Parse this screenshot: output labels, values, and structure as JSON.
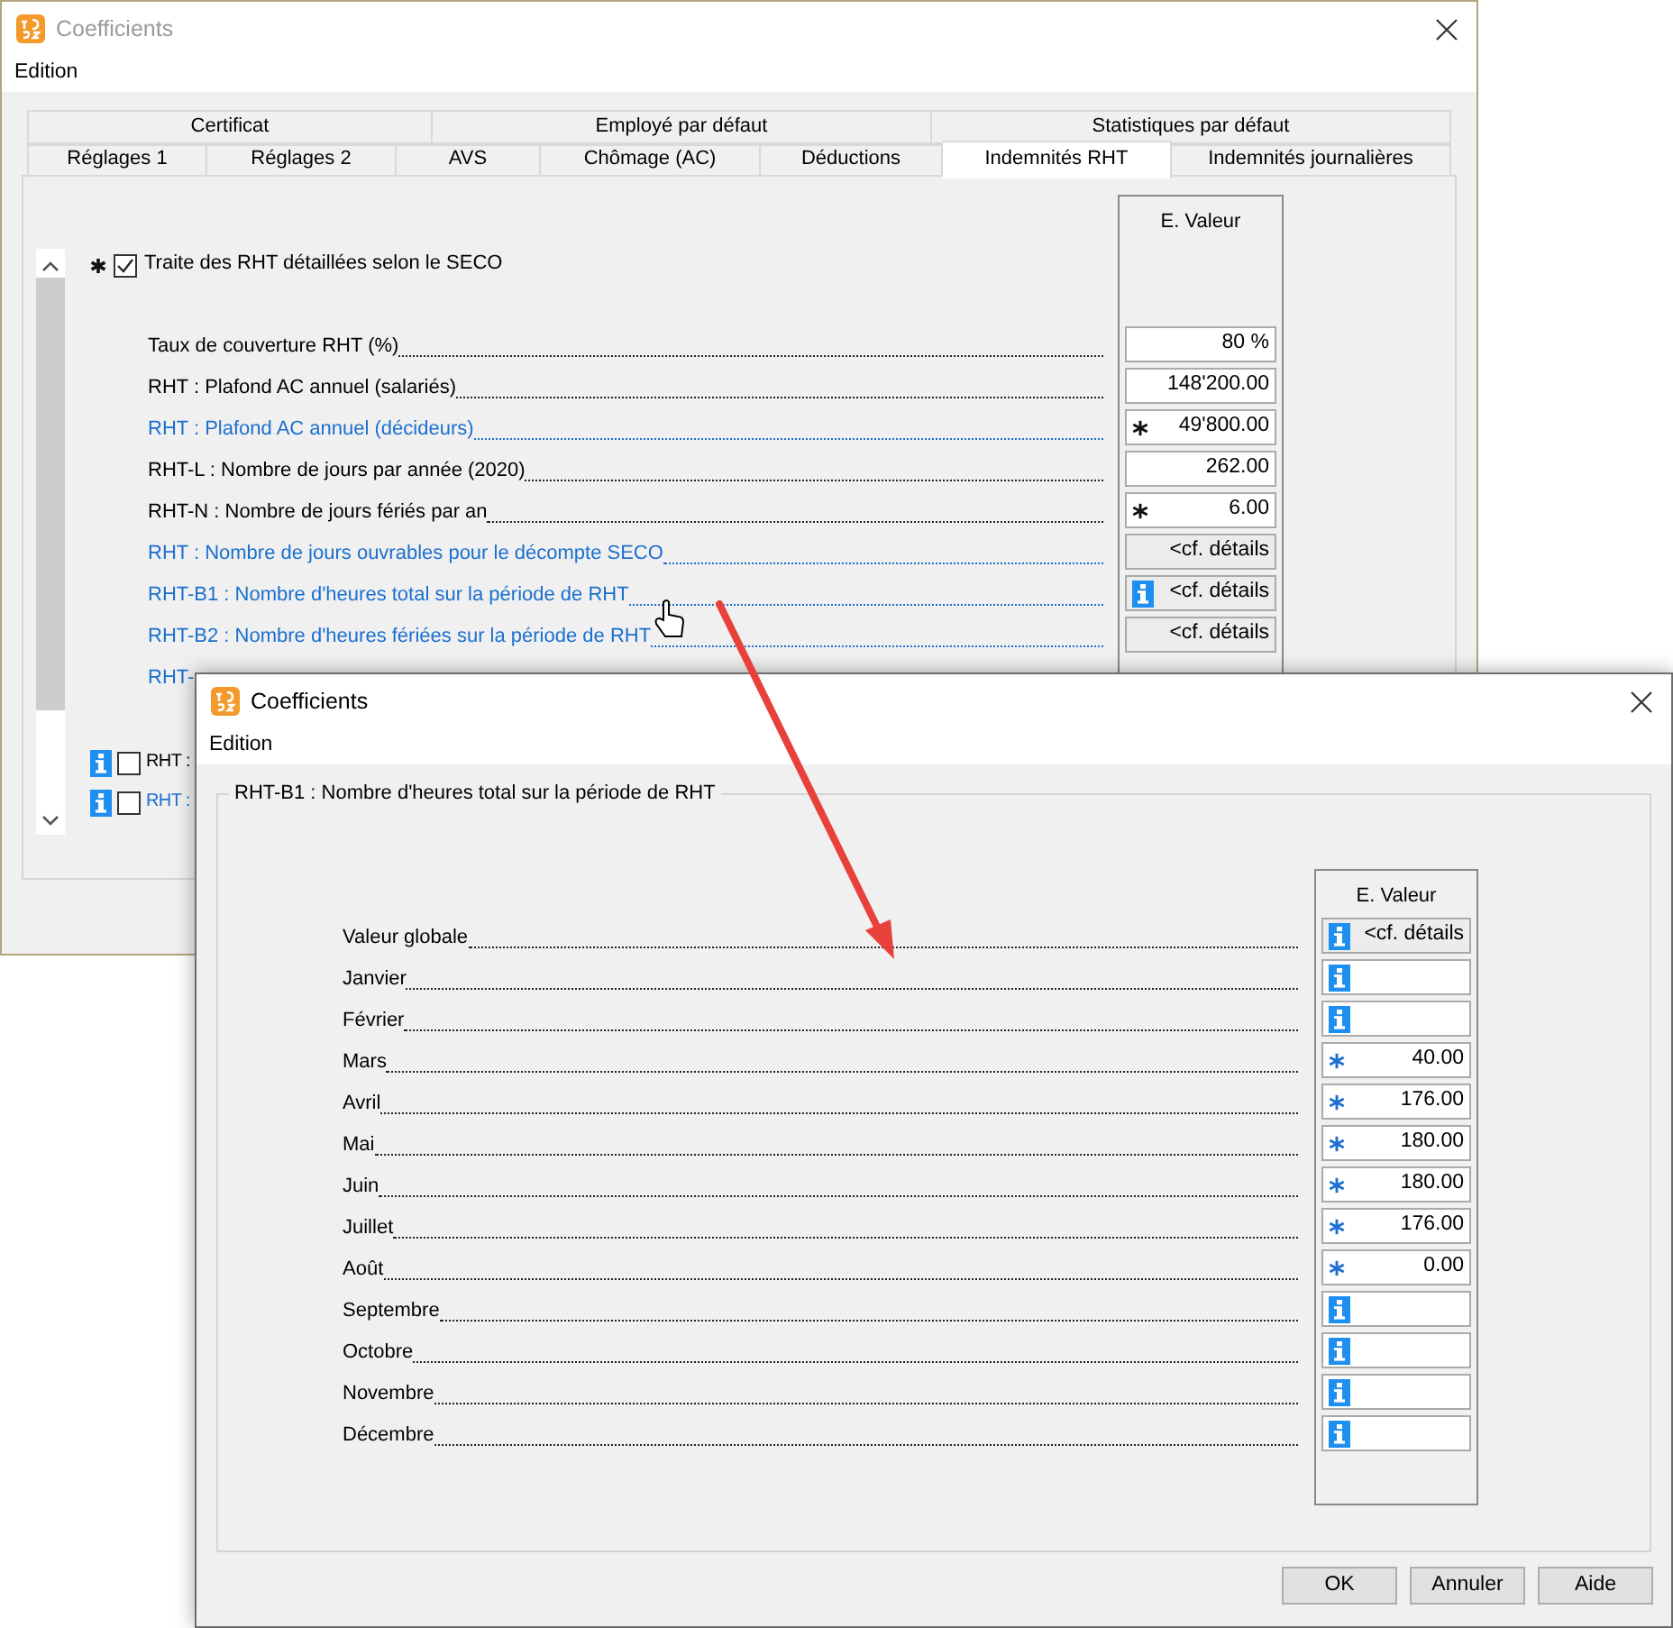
{
  "back_window": {
    "title": "Coefficients",
    "menu": [
      "Edition"
    ],
    "tabs_row1": [
      {
        "label": "Certificat",
        "selected": false
      },
      {
        "label": "Employé par défaut",
        "selected": false
      },
      {
        "label": "Statistiques par défaut",
        "selected": false
      }
    ],
    "tabs_row2": [
      {
        "label": "Réglages 1",
        "selected": false
      },
      {
        "label": "Réglages 2",
        "selected": false
      },
      {
        "label": "AVS",
        "selected": false
      },
      {
        "label": "Chômage (AC)",
        "selected": false
      },
      {
        "label": "Déductions",
        "selected": false
      },
      {
        "label": "Indemnités RHT",
        "selected": true
      },
      {
        "label": "Indemnités journalières",
        "selected": false
      }
    ],
    "column_header": "E. Valeur",
    "master": {
      "starred": true,
      "checked": true,
      "label": "Traite des RHT détaillées selon le SECO"
    },
    "rows": [
      {
        "label": "Taux de couverture RHT (%)",
        "linked": false,
        "starred": false,
        "info": false,
        "kind": "input",
        "value": "80 %"
      },
      {
        "label": "RHT : Plafond AC annuel (salariés)",
        "linked": false,
        "starred": false,
        "info": false,
        "kind": "input",
        "value": "148'200.00"
      },
      {
        "label": "RHT : Plafond AC annuel (décideurs)",
        "linked": true,
        "starred": true,
        "info": false,
        "kind": "input",
        "value": "49'800.00"
      },
      {
        "label": "RHT-L : Nombre de jours par année (2020)",
        "linked": false,
        "starred": false,
        "info": false,
        "kind": "input",
        "value": "262.00"
      },
      {
        "label": "RHT-N : Nombre de jours fériés par an",
        "linked": false,
        "starred": true,
        "info": false,
        "kind": "input",
        "value": "6.00"
      },
      {
        "label": "RHT : Nombre de jours ouvrables pour le décompte SECO",
        "linked": true,
        "starred": false,
        "info": false,
        "kind": "details",
        "value": "<cf. détails"
      },
      {
        "label": "RHT-B1 : Nombre d'heures total sur la période de RHT",
        "linked": true,
        "starred": false,
        "info": true,
        "kind": "details",
        "value": "<cf. détails"
      },
      {
        "label": "RHT-B2 : Nombre d'heures fériées sur la période de RHT",
        "linked": true,
        "starred": false,
        "info": false,
        "kind": "details",
        "value": "<cf. détails"
      },
      {
        "label": "RHT-",
        "linked": true,
        "kind": "hidden"
      }
    ],
    "extra_rows": [
      {
        "info": true,
        "checked": false,
        "label": "RHT :",
        "linked": false
      },
      {
        "info": true,
        "checked": false,
        "label": "RHT :",
        "linked": true
      }
    ]
  },
  "front_window": {
    "title": "Coefficients",
    "menu": [
      "Edition"
    ],
    "group_title": "RHT-B1 : Nombre d'heures total sur la période de RHT",
    "column_header": "E. Valeur",
    "rows": [
      {
        "label": "Valeur globale",
        "starred": false,
        "info": true,
        "kind": "details",
        "value": "<cf. détails"
      },
      {
        "label": "Janvier",
        "starred": false,
        "info": true,
        "kind": "input"
      },
      {
        "label": "Février",
        "starred": false,
        "info": true,
        "kind": "input"
      },
      {
        "label": "Mars",
        "starred": true,
        "info": false,
        "kind": "input",
        "value": "40.00"
      },
      {
        "label": "Avril",
        "starred": true,
        "info": false,
        "kind": "input",
        "value": "176.00"
      },
      {
        "label": "Mai",
        "starred": true,
        "info": false,
        "kind": "input",
        "value": "180.00"
      },
      {
        "label": "Juin",
        "starred": true,
        "info": false,
        "kind": "input",
        "value": "180.00"
      },
      {
        "label": "Juillet",
        "starred": true,
        "info": false,
        "kind": "input",
        "value": "176.00"
      },
      {
        "label": "Août",
        "starred": true,
        "info": false,
        "kind": "input",
        "value": "0.00"
      },
      {
        "label": "Septembre",
        "starred": false,
        "info": true,
        "kind": "input"
      },
      {
        "label": "Octobre",
        "starred": false,
        "info": true,
        "kind": "input"
      },
      {
        "label": "Novembre",
        "starred": false,
        "info": true,
        "kind": "input"
      },
      {
        "label": "Décembre",
        "starred": false,
        "info": true,
        "kind": "input"
      }
    ],
    "buttons": [
      "OK",
      "Annuler",
      "Aide"
    ]
  }
}
